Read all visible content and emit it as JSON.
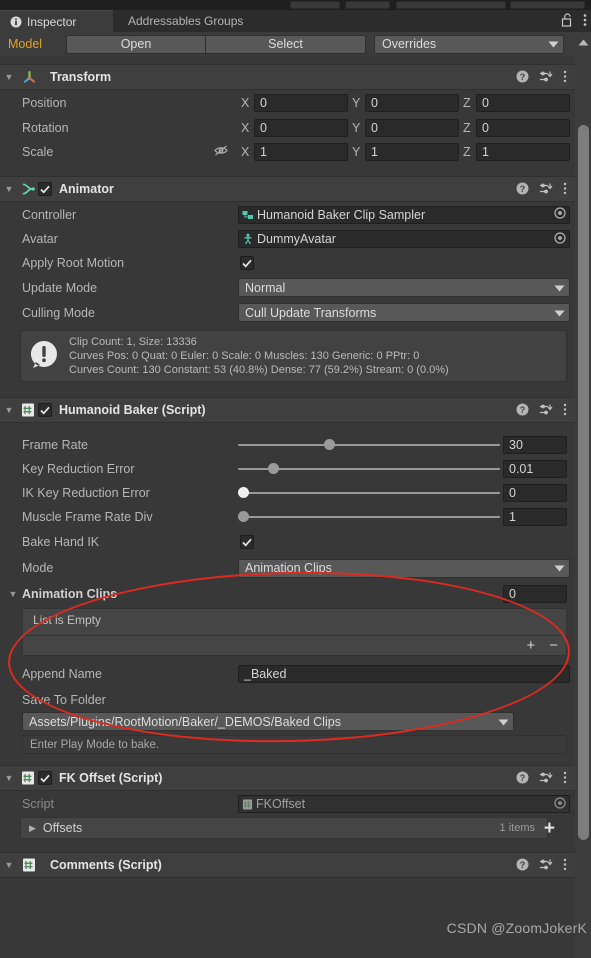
{
  "window": {
    "tabs": [
      {
        "label": "Inspector",
        "icon": "info-icon",
        "active": true
      },
      {
        "label": "Addressables Groups",
        "icon": "",
        "active": false
      }
    ],
    "lock_icon": "lock-open-icon",
    "menu_icon": "kebab-menu-icon"
  },
  "modelbar": {
    "label": "Model",
    "open_label": "Open",
    "select_label": "Select",
    "overrides_label": "Overrides"
  },
  "transform": {
    "title": "Transform",
    "icon": "transform-axis-icon",
    "rows": [
      {
        "label": "Position",
        "x": "0",
        "y": "0",
        "z": "0"
      },
      {
        "label": "Rotation",
        "x": "0",
        "y": "0",
        "z": "0"
      },
      {
        "label": "Scale",
        "x": "1",
        "y": "1",
        "z": "1",
        "link_icon": "constrain-off-icon"
      }
    ],
    "axis_x": "X",
    "axis_y": "Y",
    "axis_z": "Z"
  },
  "animator": {
    "title": "Animator",
    "icon": "animator-icon",
    "enabled": true,
    "controller_label": "Controller",
    "controller_value": "Humanoid Baker Clip Sampler",
    "avatar_label": "Avatar",
    "avatar_value": "DummyAvatar",
    "apply_root_motion_label": "Apply Root Motion",
    "apply_root_motion_value": true,
    "update_mode_label": "Update Mode",
    "update_mode_value": "Normal",
    "culling_mode_label": "Culling Mode",
    "culling_mode_value": "Cull Update Transforms",
    "info_lines": [
      "Clip Count: 1, Size: 13336",
      "Curves Pos: 0 Quat: 0 Euler: 0 Scale: 0 Muscles: 130 Generic: 0 PPtr: 0",
      "Curves Count: 130 Constant: 53 (40.8%) Dense: 77 (59.2%) Stream: 0 (0.0%)"
    ],
    "info_icon": "warning-icon"
  },
  "humanoid_baker": {
    "title": "Humanoid Baker (Script)",
    "icon": "script-icon",
    "enabled": true,
    "sliders": [
      {
        "label": "Frame Rate",
        "value": "30",
        "pos": 35
      },
      {
        "label": "Key Reduction Error",
        "value": "0.01",
        "pos": 13
      },
      {
        "label": "IK Key Reduction Error",
        "value": "0",
        "pos": 0,
        "light": true
      },
      {
        "label": "Muscle Frame Rate Div",
        "value": "1",
        "pos": 0
      }
    ],
    "bake_hand_ik_label": "Bake Hand IK",
    "bake_hand_ik_value": true,
    "mode_label": "Mode",
    "mode_value": "Animation Clips",
    "clips_label": "Animation Clips",
    "clips_count": "0",
    "list_empty_label": "List is Empty",
    "add_label": "+",
    "remove_label": "−",
    "append_name_label": "Append Name",
    "append_name_value": "_Baked",
    "save_folder_label": "Save To Folder",
    "save_folder_value": "Assets/Plugins/RootMotion/Baker/_DEMOS/Baked Clips",
    "status_text": "Enter Play Mode to bake."
  },
  "fk_offset": {
    "title": "FK Offset (Script)",
    "icon": "script-icon",
    "enabled": true,
    "script_label": "Script",
    "script_value": "FKOffset",
    "offsets_label": "Offsets",
    "offsets_count": "1 items",
    "add_label": "+"
  },
  "comments": {
    "title": "Comments (Script)",
    "icon": "script-icon"
  },
  "watermark": "CSDN @ZoomJokerK",
  "colors": {
    "accent_yellow": "#e0a526",
    "annotation_red": "#e02a1e",
    "teal": "#4ec9b0",
    "panel_bg": "#383838",
    "header_bg": "#3f3f3f"
  }
}
